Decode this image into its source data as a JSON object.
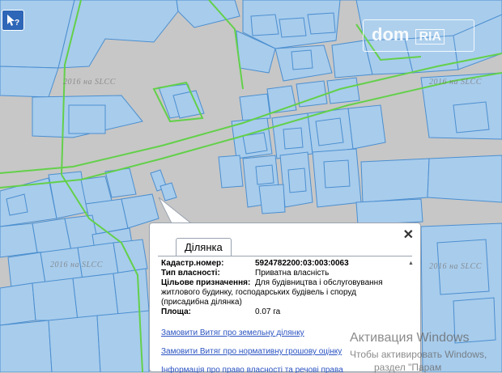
{
  "map": {
    "watermark_dom": "dom",
    "watermark_ria": "RIA",
    "source_label": "2016 на SLCC"
  },
  "toolbar": {
    "help_tool_icon": "pointer-question-icon"
  },
  "popup": {
    "tab_label": "Ділянка",
    "close_icon": "close-icon",
    "fields": {
      "cadastre_label": "Кадастр.номер:",
      "cadastre_value": "5924782200:03:003:0063",
      "ownership_label": "Тип власності:",
      "ownership_value": "Приватна власність",
      "purpose_label": "Цільове призначення:",
      "purpose_value_line1": "Для будівництва і обслуговування",
      "purpose_value_line2": "житлового будинку, господарських будівель і споруд",
      "purpose_value_line3": "(присадибна ділянка)",
      "area_label": "Площа:",
      "area_value": "0.07 га"
    },
    "links": {
      "order_land": "Замовити Витяг про земельну ділянку",
      "order_valuation": "Замовити Витяг про нормативну грошову оцінку",
      "info_partial": "Інформація про право власності та речові права"
    }
  },
  "os_overlay": {
    "title": "Активация Windows",
    "line2": "Чтобы активировать Windows,",
    "line3": "раздел \"Парам"
  },
  "colors": {
    "map_background": "#c7c7c7",
    "parcel_fill": "#a8ccec",
    "parcel_stroke": "#4b8fd0",
    "boundary_green": "#63d04a",
    "link_blue": "#2a53c1"
  }
}
